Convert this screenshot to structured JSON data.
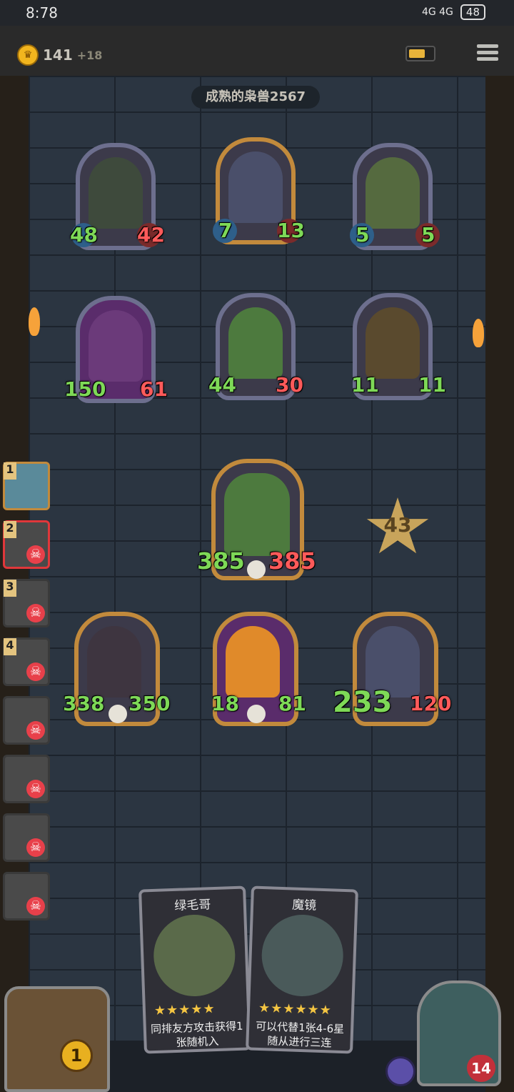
{
  "status_bar": {
    "time": "8:78",
    "network": "4G 4G",
    "battery": "48"
  },
  "top_bar": {
    "gold": "141",
    "gold_plus": "+18"
  },
  "opponent": {
    "name": "成熟的枭兽2567"
  },
  "enemy_row1": [
    {
      "atk": "48",
      "hp": "42"
    },
    {
      "atk": "7",
      "hp": "13"
    },
    {
      "atk": "5",
      "hp": "5"
    }
  ],
  "enemy_row2": [
    {
      "atk": "150",
      "hp": "61"
    },
    {
      "atk": "44",
      "hp": "30"
    },
    {
      "atk": "11",
      "hp": "11"
    }
  ],
  "player_top": {
    "atk": "385",
    "hp": "385"
  },
  "player_row": [
    {
      "atk": "338",
      "hp": "350"
    },
    {
      "atk": "18",
      "hp": "81"
    },
    {
      "atk": "233",
      "hp": "120"
    }
  ],
  "tavern_level": "43",
  "queue_numbers": [
    "1",
    "2",
    "3",
    "4"
  ],
  "hand": [
    {
      "title": "绿毛哥",
      "stars": "★★★★★",
      "desc": "同排友方攻击获得1张随机入"
    },
    {
      "title": "魔镜",
      "stars": "★★★★★★",
      "desc": "可以代替1张4-6星随从进行三连"
    }
  ],
  "chest_count": "1",
  "hero_hp": "14"
}
